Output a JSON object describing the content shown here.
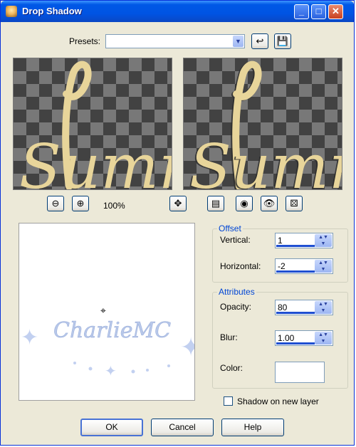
{
  "window": {
    "title": "Drop Shadow"
  },
  "presets": {
    "label": "Presets:",
    "value": ""
  },
  "preview": {
    "zoom": "100%"
  },
  "offset": {
    "title": "Offset",
    "vertical_label": "Vertical:",
    "vertical_value": "1",
    "horizontal_label": "Horizontal:",
    "horizontal_value": "-2"
  },
  "attributes": {
    "title": "Attributes",
    "opacity_label": "Opacity:",
    "opacity_value": "80",
    "blur_label": "Blur:",
    "blur_value": "1.00",
    "color_label": "Color:",
    "color_value": "#ffffff"
  },
  "shadow_new_layer": {
    "label": "Shadow on new layer",
    "checked": false
  },
  "buttons": {
    "ok": "OK",
    "cancel": "Cancel",
    "help": "Help"
  },
  "image_text": {
    "preview_word": "Summ",
    "watermark": "CharlieMC"
  }
}
